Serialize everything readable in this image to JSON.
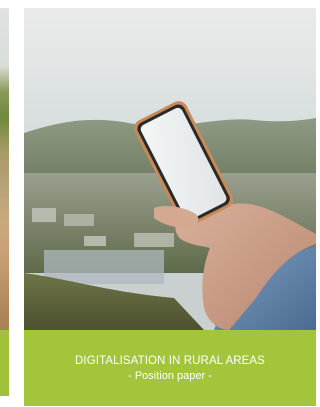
{
  "card_main": {
    "title": "DIGITALISATION IN RURAL AREAS",
    "subtitle": "- Position paper -",
    "image_icon": "smartphone-in-hand-photo"
  },
  "card_left": {
    "image_icon": "rural-landscape-photo"
  },
  "colors": {
    "band_green": "#a2c53b",
    "band_text": "#ffffff"
  }
}
